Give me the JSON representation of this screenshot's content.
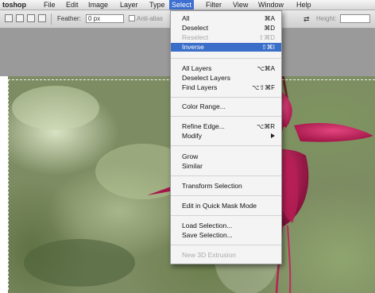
{
  "menubar": {
    "app": "toshop",
    "items": [
      "File",
      "Edit",
      "Image",
      "Layer",
      "Type",
      "Select",
      "Filter",
      "View",
      "Window",
      "Help"
    ]
  },
  "options": {
    "feather_label": "Feather:",
    "feather_value": "0 px",
    "antialias_label": "Anti-alias",
    "height_label": "Height:"
  },
  "select_menu": {
    "all": {
      "label": "All",
      "shortcut": "⌘A"
    },
    "deselect": {
      "label": "Deselect",
      "shortcut": "⌘D"
    },
    "reselect": {
      "label": "Reselect",
      "shortcut": "⇧⌘D"
    },
    "inverse": {
      "label": "Inverse",
      "shortcut": "⇧⌘I"
    },
    "all_layers": {
      "label": "All Layers",
      "shortcut": "⌥⌘A"
    },
    "deselect_layers": {
      "label": "Deselect Layers"
    },
    "find_layers": {
      "label": "Find Layers",
      "shortcut": "⌥⇧⌘F"
    },
    "color_range": {
      "label": "Color Range..."
    },
    "refine_edge": {
      "label": "Refine Edge...",
      "shortcut": "⌥⌘R"
    },
    "modify": {
      "label": "Modify"
    },
    "grow": {
      "label": "Grow"
    },
    "similar": {
      "label": "Similar"
    },
    "transform_selection": {
      "label": "Transform Selection"
    },
    "quick_mask": {
      "label": "Edit in Quick Mask Mode"
    },
    "load_selection": {
      "label": "Load Selection..."
    },
    "save_selection": {
      "label": "Save Selection..."
    },
    "new_3d_extrusion": {
      "label": "New 3D Extrusion"
    }
  },
  "colors": {
    "highlight": "#3a6ec9",
    "flower": "#c2265a",
    "foliage": "#7d8c62"
  }
}
